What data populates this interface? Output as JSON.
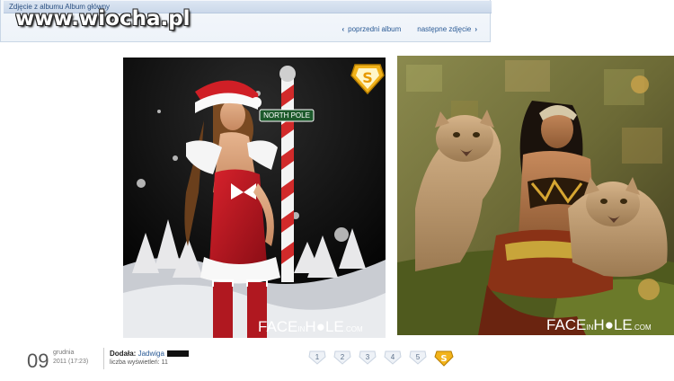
{
  "watermark": "www.wiocha.pl",
  "header": {
    "title": "Zdjęcie z albumu Album główny",
    "prev_label": "poprzedni album",
    "next_label": "następne zdjęcie"
  },
  "photos": {
    "left": {
      "sign_text": "NORTH POLE",
      "badge_text": "SUPER ZDJĘCIE",
      "logo_main": "FACE",
      "logo_in": "IN",
      "logo_hole": "H",
      "logo_le": "LE",
      "logo_com": ".COM"
    },
    "right": {
      "logo_main": "FACE",
      "logo_in": "IN",
      "logo_hole": "H",
      "logo_le": "LE",
      "logo_com": ".COM"
    }
  },
  "footer": {
    "day": "09",
    "month": "grudnia",
    "time": "2011 (17:23)",
    "added_label": "Dodała:",
    "added_user": "Jadwiga",
    "views_label": "liczba wyświetleń:",
    "views_count": "11"
  },
  "rating": {
    "buttons": [
      "1",
      "2",
      "3",
      "4",
      "5"
    ],
    "super_icon": "super-s-badge-icon"
  },
  "colors": {
    "link": "#2a5a95",
    "header_bg": "#eef3f9",
    "badge_gold": "#f2b31b"
  }
}
